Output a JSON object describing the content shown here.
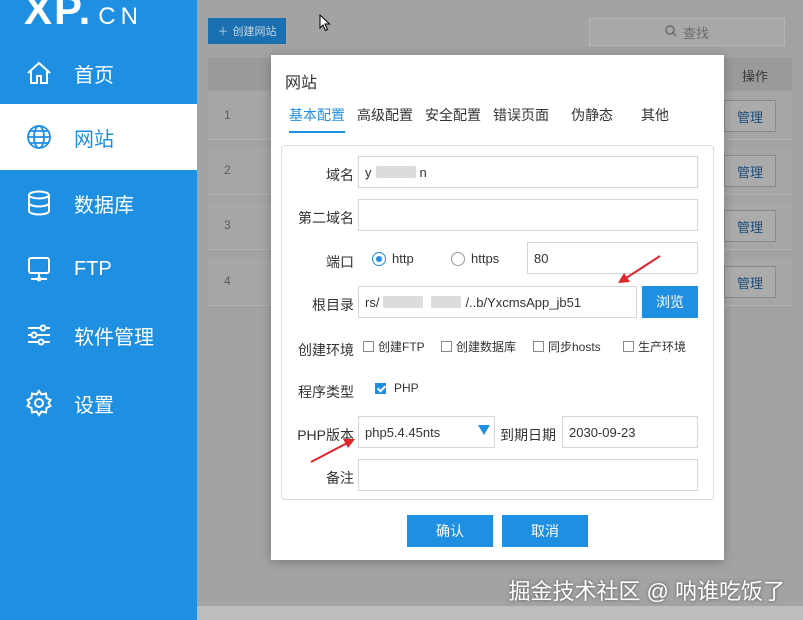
{
  "app": {
    "logo_main": "XP.",
    "logo_suffix": "CN"
  },
  "sidebar": {
    "items": [
      {
        "label": "首页",
        "icon": "home-icon"
      },
      {
        "label": "网站",
        "icon": "globe-icon",
        "active": true
      },
      {
        "label": "数据库",
        "icon": "database-icon"
      },
      {
        "label": "FTP",
        "icon": "server-icon"
      },
      {
        "label": "软件管理",
        "icon": "sliders-icon"
      },
      {
        "label": "设置",
        "icon": "gear-icon"
      }
    ]
  },
  "toolbar": {
    "create_label": "创建网站",
    "search_placeholder": "查找"
  },
  "table": {
    "op_header": "操作",
    "rows": [
      {
        "num": "1",
        "action": "管理"
      },
      {
        "num": "2",
        "action": "管理"
      },
      {
        "num": "3",
        "action": "管理"
      },
      {
        "num": "4",
        "action": "管理"
      }
    ]
  },
  "dialog": {
    "title": "网站",
    "tabs": [
      "基本配置",
      "高级配置",
      "安全配置",
      "错误页面",
      "伪静态",
      "其他"
    ],
    "active_tab": 0,
    "fields": {
      "domain_label": "域名",
      "domain_start": "y",
      "domain_end": "n",
      "second_domain_label": "第二域名",
      "second_domain_value": "",
      "port_label": "端口",
      "protocol_http": "http",
      "protocol_https": "https",
      "selected_protocol": "http",
      "port_value": "80",
      "root_label": "根目录",
      "root_start": "rs/",
      "root_end": "/..b/YxcmsApp_jb51",
      "browse_label": "浏览",
      "env_label": "创建环境",
      "env_options": [
        {
          "label": "创建FTP",
          "checked": false
        },
        {
          "label": "创建数据库",
          "checked": false
        },
        {
          "label": "同步hosts",
          "checked": false
        },
        {
          "label": "生产环境",
          "checked": false
        }
      ],
      "program_type_label": "程序类型",
      "program_type_option": "PHP",
      "program_type_checked": true,
      "php_version_label": "PHP版本",
      "php_version_value": "php5.4.45nts",
      "expire_label": "到期日期",
      "expire_value": "2030-09-23",
      "remark_label": "备注",
      "remark_value": ""
    },
    "confirm_label": "确认",
    "cancel_label": "取消"
  },
  "watermark": "掘金技术社区 @ 呐谁吃饭了",
  "colors": {
    "accent": "#1e8fe1",
    "annotation_arrow": "#e0262b"
  }
}
